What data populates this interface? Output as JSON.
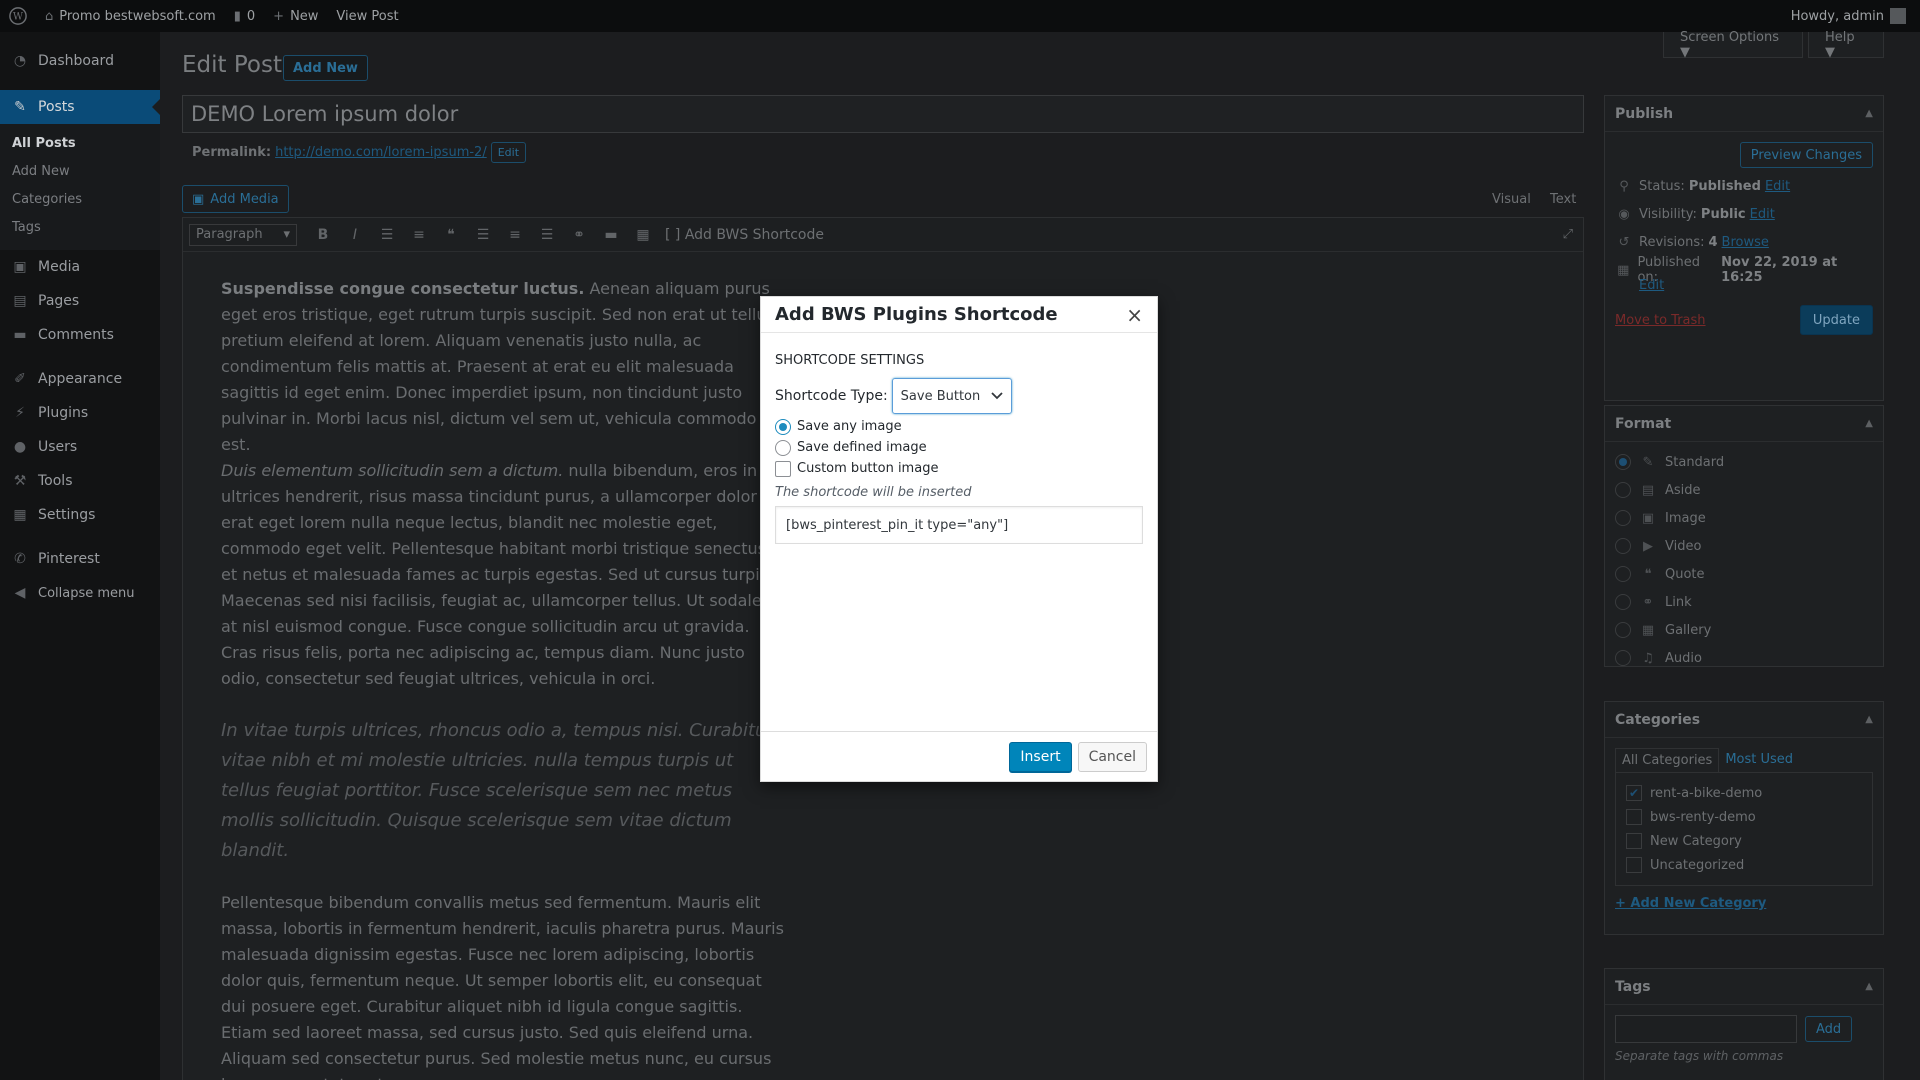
{
  "adminbar": {
    "site_name": "Promo bestwebsoft.com",
    "comments_count": "0",
    "new_label": "New",
    "view_post": "View Post",
    "howdy": "Howdy, admin"
  },
  "menu": {
    "dashboard": "Dashboard",
    "posts": "Posts",
    "posts_sub": [
      "All Posts",
      "Add New",
      "Categories",
      "Tags"
    ],
    "media": "Media",
    "pages": "Pages",
    "comments": "Comments",
    "appearance": "Appearance",
    "plugins": "Plugins",
    "users": "Users",
    "tools": "Tools",
    "settings": "Settings",
    "pinterest": "Pinterest",
    "collapse": "Collapse menu"
  },
  "screen_meta": {
    "screen_options": "Screen Options ▼",
    "help": "Help ▼"
  },
  "page": {
    "title": "Edit Post",
    "add_new": "Add New",
    "post_title": "DEMO Lorem ipsum dolor",
    "permalink_label": "Permalink:",
    "permalink_url": "http://demo.com/lorem-ipsum-2/",
    "permalink_edit": "Edit",
    "add_media": "Add Media",
    "tab_visual": "Visual",
    "tab_text": "Text",
    "format_select": "Paragraph",
    "bws_shortcode": "Add BWS Shortcode"
  },
  "content": {
    "p1_strong": "Suspendisse congue consectetur luctus.",
    "p1_rest": " Aenean aliquam purus eget eros tristique, eget rutrum turpis suscipit. Sed non erat ut tellus pretium eleifend at lorem. Aliquam venenatis justo nulla, ac condimentum felis mattis at. Praesent at erat eu elit malesuada sagittis id eget enim. Donec imperdiet ipsum, non tincidunt justo pulvinar in. Morbi lacus nisl, dictum vel sem ut, vehicula commodo est.",
    "p2_em": "Duis elementum sollicitudin sem a dictum.",
    "p2_rest": " nulla bibendum, eros in ultrices hendrerit, risus massa tincidunt purus, a ullamcorper dolor erat eget lorem nulla neque lectus, blandit nec molestie eget, commodo eget velit. Pellentesque habitant morbi tristique senectus et netus et malesuada fames ac turpis egestas. Sed ut cursus turpis. Maecenas sed nisi facilisis, feugiat ac, ullamcorper tellus. Ut sodales at nisl euismod congue. Fusce congue sollicitudin arcu ut gravida. Cras risus felis, porta nec adipiscing ac, tempus diam. Nunc justo odio, consectetur sed feugiat ultrices, vehicula in orci.",
    "quote": "In vitae turpis ultrices, rhoncus odio a, tempus nisi. Curabitur vitae nibh et mi molestie ultricies. nulla tempus turpis ut tellus feugiat porttitor. Fusce scelerisque sem nec metus mollis sollicitudin. Quisque scelerisque sem vitae dictum blandit.",
    "p3": "Pellentesque bibendum convallis metus sed fermentum. Mauris elit massa, lobortis in fermentum hendrerit, iaculis pharetra purus. Mauris malesuada dignissim egestas. Fusce nec lorem adipiscing, lobortis dolor quis, fermentum neque. Ut semper lobortis elit, eu consequat dui posuere eget. Curabitur aliquet nibh id ligula congue sagittis. Etiam sed laoreet massa, sed cursus justo. Sed quis eleifend urna. Aliquam sed consectetur purus. Sed molestie metus nunc, eu cursus lacus consectetur et."
  },
  "publish": {
    "heading": "Publish",
    "preview": "Preview Changes",
    "status_label": "Status:",
    "status_value": "Published",
    "visibility_label": "Visibility:",
    "visibility_value": "Public",
    "revisions_label": "Revisions:",
    "revisions_value": "4",
    "browse": "Browse",
    "published_label": "Published on:",
    "published_value": "Nov 22, 2019 at 16:25",
    "edit": "Edit",
    "trash": "Move to Trash",
    "update": "Update"
  },
  "format": {
    "heading": "Format",
    "options": [
      "Standard",
      "Aside",
      "Image",
      "Video",
      "Quote",
      "Link",
      "Gallery",
      "Audio"
    ]
  },
  "categories": {
    "heading": "Categories",
    "tab_all": "All Categories",
    "tab_most": "Most Used",
    "items": [
      "rent-a-bike-demo",
      "bws-renty-demo",
      "New Category",
      "Uncategorized"
    ],
    "add_new": "+ Add New Category"
  },
  "tags": {
    "heading": "Tags",
    "add": "Add",
    "hint": "Separate tags with commas"
  },
  "dialog": {
    "title": "Add BWS Plugins Shortcode",
    "close": "×",
    "section": "SHORTCODE SETTINGS",
    "type_label": "Shortcode Type:",
    "type_value": "Save Button",
    "opt_any": "Save any image",
    "opt_defined": "Save defined image",
    "opt_custom": "Custom button image",
    "note": "The shortcode will be inserted",
    "code": "[bws_pinterest_pin_it type=\"any\"]",
    "insert": "Insert",
    "cancel": "Cancel"
  }
}
